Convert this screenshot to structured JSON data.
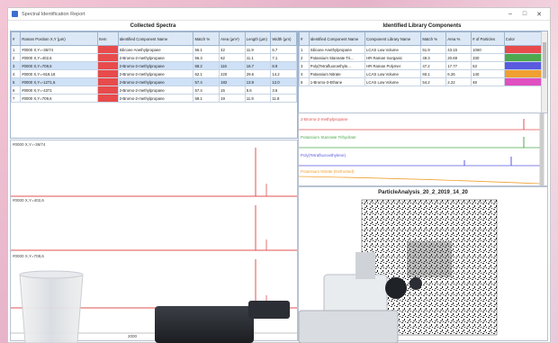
{
  "window": {
    "title": "Spectral Identification Report"
  },
  "left": {
    "title": "Collected Spectra",
    "columns": [
      "#",
      "Raman Position X,Y (µm)",
      "Item",
      "Identified Component Name",
      "Match %",
      "Area (µm²)",
      "Length (µm)",
      "Width (µm)"
    ],
    "rows": [
      [
        "1",
        "#0000 X,Y=-36/74",
        "",
        "Silicone Anethylpropane",
        "56.1",
        "42",
        "11.9",
        "6.7"
      ],
      [
        "2",
        "#0000 X,Y=402,6",
        "",
        "2-Bromo-2-methylpropane",
        "56.3",
        "62",
        "11.1",
        "7.1"
      ],
      [
        "3",
        "#0000 X,Y=708,6",
        "",
        "2-Bromo-2-methylpropane",
        "58.2",
        "116",
        "16.7",
        "8.9"
      ],
      [
        "4",
        "#0000 X,Y=-818,18",
        "",
        "2-Bromo-2-methylpropane",
        "62.1",
        "220",
        "29.6",
        "14.2"
      ],
      [
        "5",
        "#0000 X,Y=-1271,6",
        "",
        "2-Bromo-2-methylpropane",
        "57.4",
        "182",
        "13.9",
        "12.0"
      ],
      [
        "6",
        "#0000 X,Y=-4371",
        "",
        "2-Bromo-2-methylpropane",
        "57.4",
        "15",
        "5.6",
        "3.6"
      ],
      [
        "7",
        "#0000 X,Y=709,6",
        "",
        "2-Bromo-2-methylpropane",
        "58.1",
        "19",
        "11.9",
        "11.8"
      ]
    ]
  },
  "right": {
    "title": "Identified Library Components",
    "columns": [
      "#",
      "Identified Component Name",
      "Component Library Name",
      "Match %",
      "Area %",
      "# of Particles",
      "Color"
    ],
    "rows": [
      [
        "1",
        "Silicone Anethylpropane",
        "LCAS Low Volume",
        "51.9",
        "43.15",
        "1060",
        ""
      ],
      [
        "2",
        "Potassium Stannate Tri...",
        "HR Raman Inorganic",
        "49.3",
        "20.69",
        "330",
        ""
      ],
      [
        "3",
        "Poly(Tetrafluoroethyle...",
        "HR Raman Polymer",
        "47.2",
        "17.77",
        "53",
        ""
      ],
      [
        "4",
        "Potassium Nitrate",
        "LCAS Low Volume",
        "60.1",
        "6.26",
        "140",
        ""
      ],
      [
        "5",
        "1-Bromo-3-Ethane",
        "LCAS Low Volume",
        "54.2",
        "2.22",
        "48",
        ""
      ]
    ],
    "colors": [
      "#e84b4b",
      "#4ea84e",
      "#5a5ae0",
      "#f0a030",
      "#e050c0"
    ]
  },
  "spectra": {
    "labels": [
      "#0000 X,Y=-36/74",
      "#0000 X,Y=402,6",
      "#0000 X,Y=708,6"
    ],
    "xtick": "2000"
  },
  "library": {
    "labels": [
      "2-Bromo-2-methylpropane",
      "Potassium Stannate Trihydrate",
      "Poly(Tetrafluoroethylene)",
      "Potassium Nitrate (Defrosted)"
    ]
  },
  "particle": {
    "title": "ParticleAnalysis_20_2_2019_14_20"
  }
}
